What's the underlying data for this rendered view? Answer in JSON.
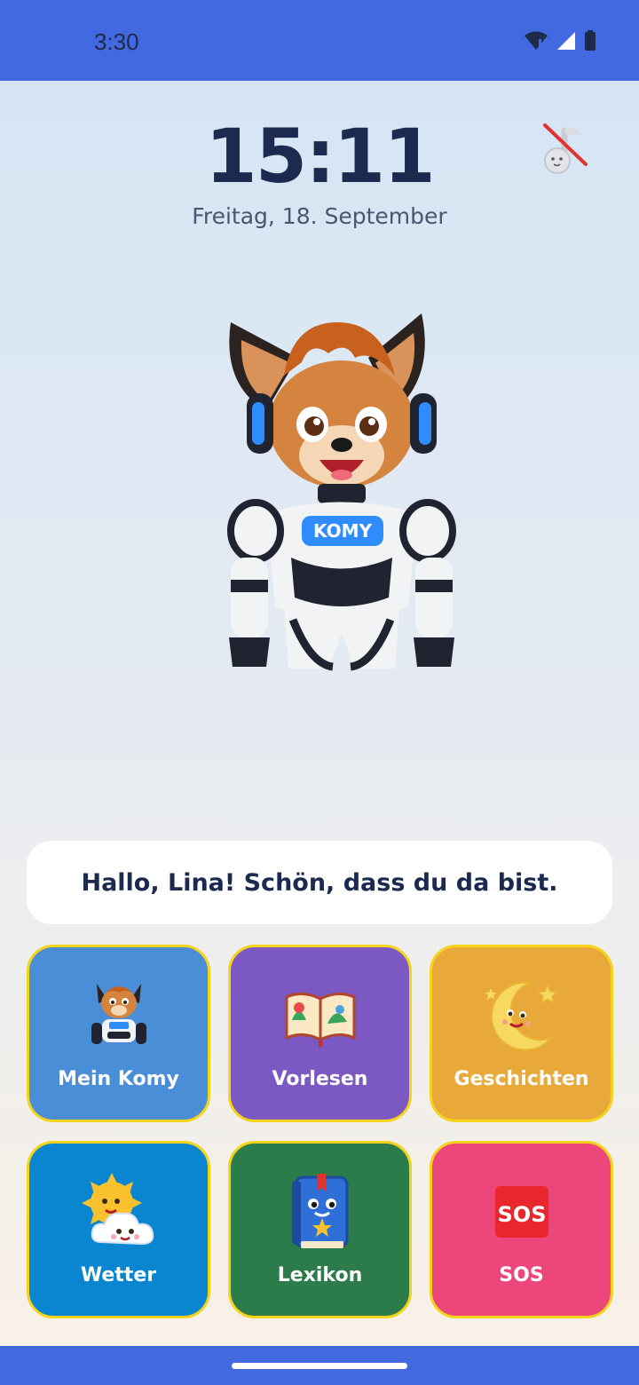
{
  "status_bar": {
    "time": "3:30",
    "icons": [
      "wifi-icon",
      "signal-icon",
      "battery-icon"
    ]
  },
  "clock": {
    "time": "15:11",
    "date": "Freitag, 18. September"
  },
  "music_toggle": {
    "icon": "music-muted-icon"
  },
  "mascot": {
    "badge": "KOMY"
  },
  "greeting": {
    "text": "Hallo, Lina! Schön, dass du da bist."
  },
  "tiles": [
    {
      "label": "Mein Komy",
      "icon": "komy-mascot-icon",
      "color": "#4a8ed8"
    },
    {
      "label": "Vorlesen",
      "icon": "open-book-icon",
      "color": "#7c58c2"
    },
    {
      "label": "Geschichten",
      "icon": "moon-icon",
      "color": "#e9a93a"
    },
    {
      "label": "Wetter",
      "icon": "sun-cloud-icon",
      "color": "#0a86d0"
    },
    {
      "label": "Lexikon",
      "icon": "lexicon-book-icon",
      "color": "#2c7b4a"
    },
    {
      "label": "SOS",
      "icon": "sos-icon",
      "icon_text": "SOS",
      "color": "#ec467a"
    }
  ],
  "colors": {
    "bars": "#4369e0",
    "tile_border": "#f5d31a",
    "text_dark": "#1b2a4e"
  }
}
